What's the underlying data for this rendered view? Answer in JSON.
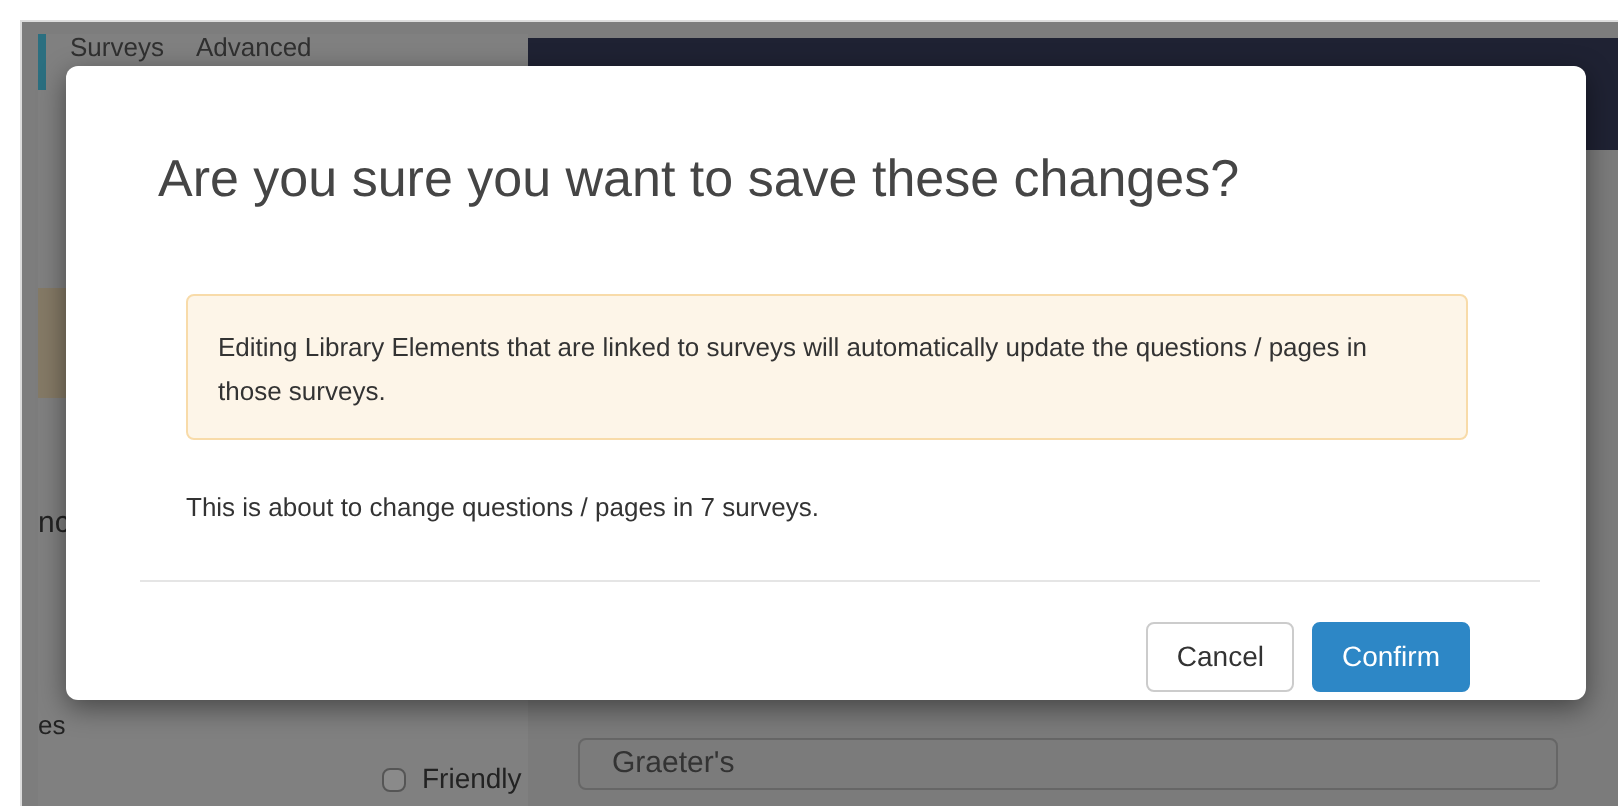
{
  "background": {
    "tabs": [
      "Surveys",
      "Advanced"
    ],
    "fragments": [
      "nc",
      "es"
    ],
    "option": {
      "label": "Friendly",
      "checked": false
    },
    "field": {
      "value": "Graeter's"
    }
  },
  "dialog": {
    "title": "Are you sure you want to save these changes?",
    "alert": "Editing Library Elements that are linked to surveys will automatically update the questions / pages in those surveys.",
    "message": "This is about to change questions / pages in 7 surveys.",
    "buttons": [
      {
        "label": "Cancel",
        "kind": "secondary"
      },
      {
        "label": "Confirm",
        "kind": "primary"
      }
    ]
  }
}
